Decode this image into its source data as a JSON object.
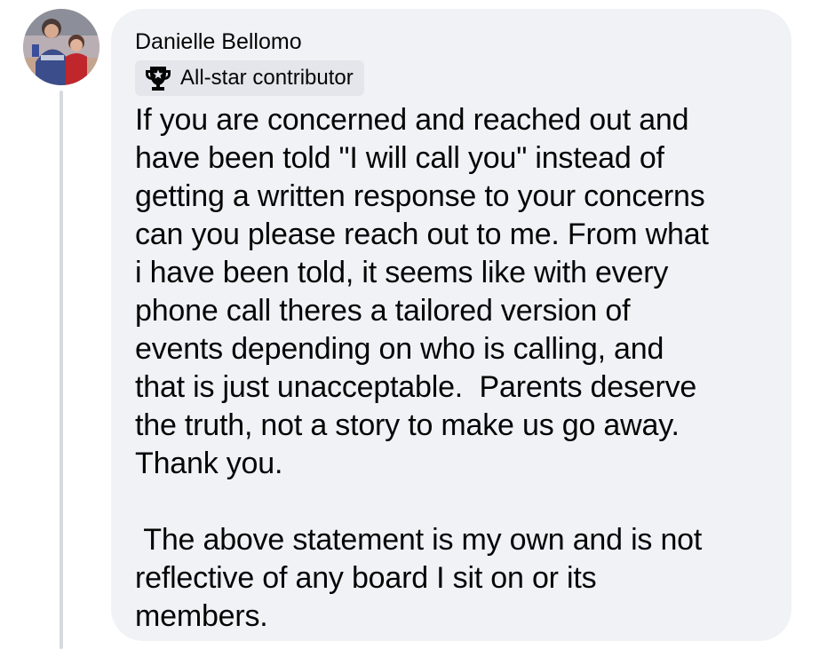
{
  "comment": {
    "author_name": "Danielle Bellomo",
    "badge_icon": "trophy-star-icon",
    "badge_label": "All-star contributor",
    "body": "If you are concerned and reached out and\nhave been told \"I will call you\" instead of\ngetting a written response to your concerns\ncan you please reach out to me. From what\ni have been told, it seems like with every\nphone call theres a tailored version of\nevents depending on who is calling, and\nthat is just unacceptable.  Parents deserve\nthe truth, not a story to make us go away.\nThank you.",
    "statement": " The above statement is my own and is not\nreflective of any board I sit on or its\nmembers."
  },
  "colors": {
    "bubble_background": "#f0f2f5",
    "badge_background": "#e4e6eb",
    "text": "#050505",
    "thread_line": "#d6d9de"
  }
}
